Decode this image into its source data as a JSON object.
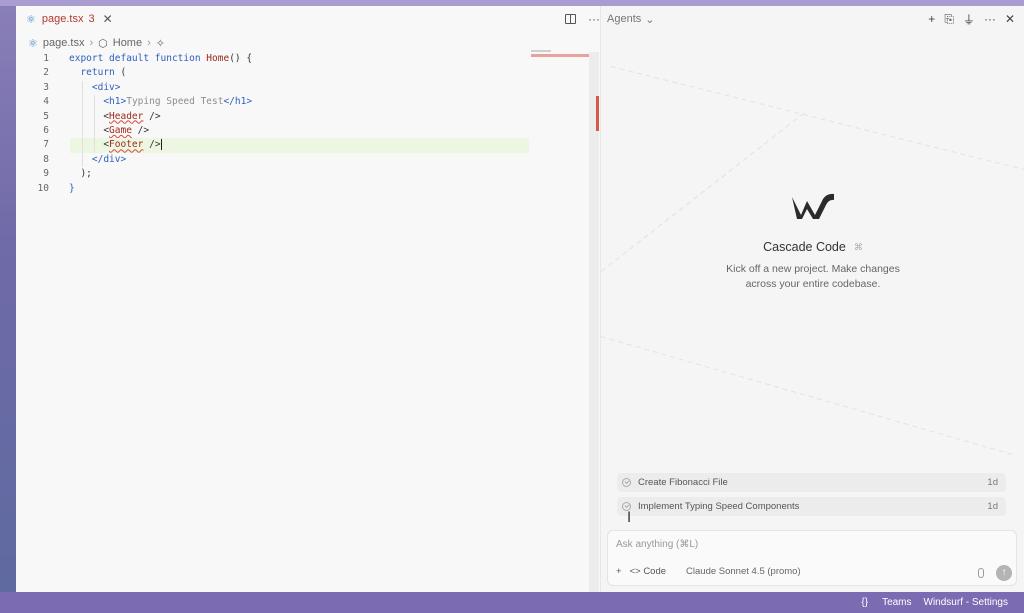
{
  "editor": {
    "tab": {
      "filename": "page.tsx",
      "problems": "3",
      "close": "✕"
    },
    "tab_actions": {
      "more": "···"
    },
    "breadcrumb": {
      "file": "page.tsx",
      "sep1": "›",
      "symbol": "Home",
      "sep2": "›"
    },
    "lines": [
      {
        "n": "1"
      },
      {
        "n": "2"
      },
      {
        "n": "3"
      },
      {
        "n": "4"
      },
      {
        "n": "5"
      },
      {
        "n": "6"
      },
      {
        "n": "7"
      },
      {
        "n": "8"
      },
      {
        "n": "9"
      },
      {
        "n": "10"
      }
    ]
  },
  "agent": {
    "title": "Agents",
    "chevron": "⌄",
    "actions": {
      "add": "+",
      "more": "···",
      "close": "✕"
    },
    "hero": {
      "title": "Cascade Code",
      "shortcut": "⌘",
      "subtitle_line1": "Kick off a new project. Make changes",
      "subtitle_line2": "across your entire codebase."
    },
    "conversations": [
      {
        "title": "Create Fibonacci File",
        "age": "1d"
      },
      {
        "title": "Implement Typing Speed Components",
        "age": "1d"
      }
    ],
    "input": {
      "placeholder": "Ask anything (⌘L)",
      "add": "+",
      "mode": "Code",
      "model": "Claude Sonnet 4.5 (promo)",
      "send": "↑"
    }
  },
  "statusbar": {
    "teams": "Teams",
    "settings": "Windsurf - Settings"
  },
  "colors": {
    "accent": "#7b6bb2",
    "error": "#b2392f",
    "keyword": "#2d5fbf"
  }
}
